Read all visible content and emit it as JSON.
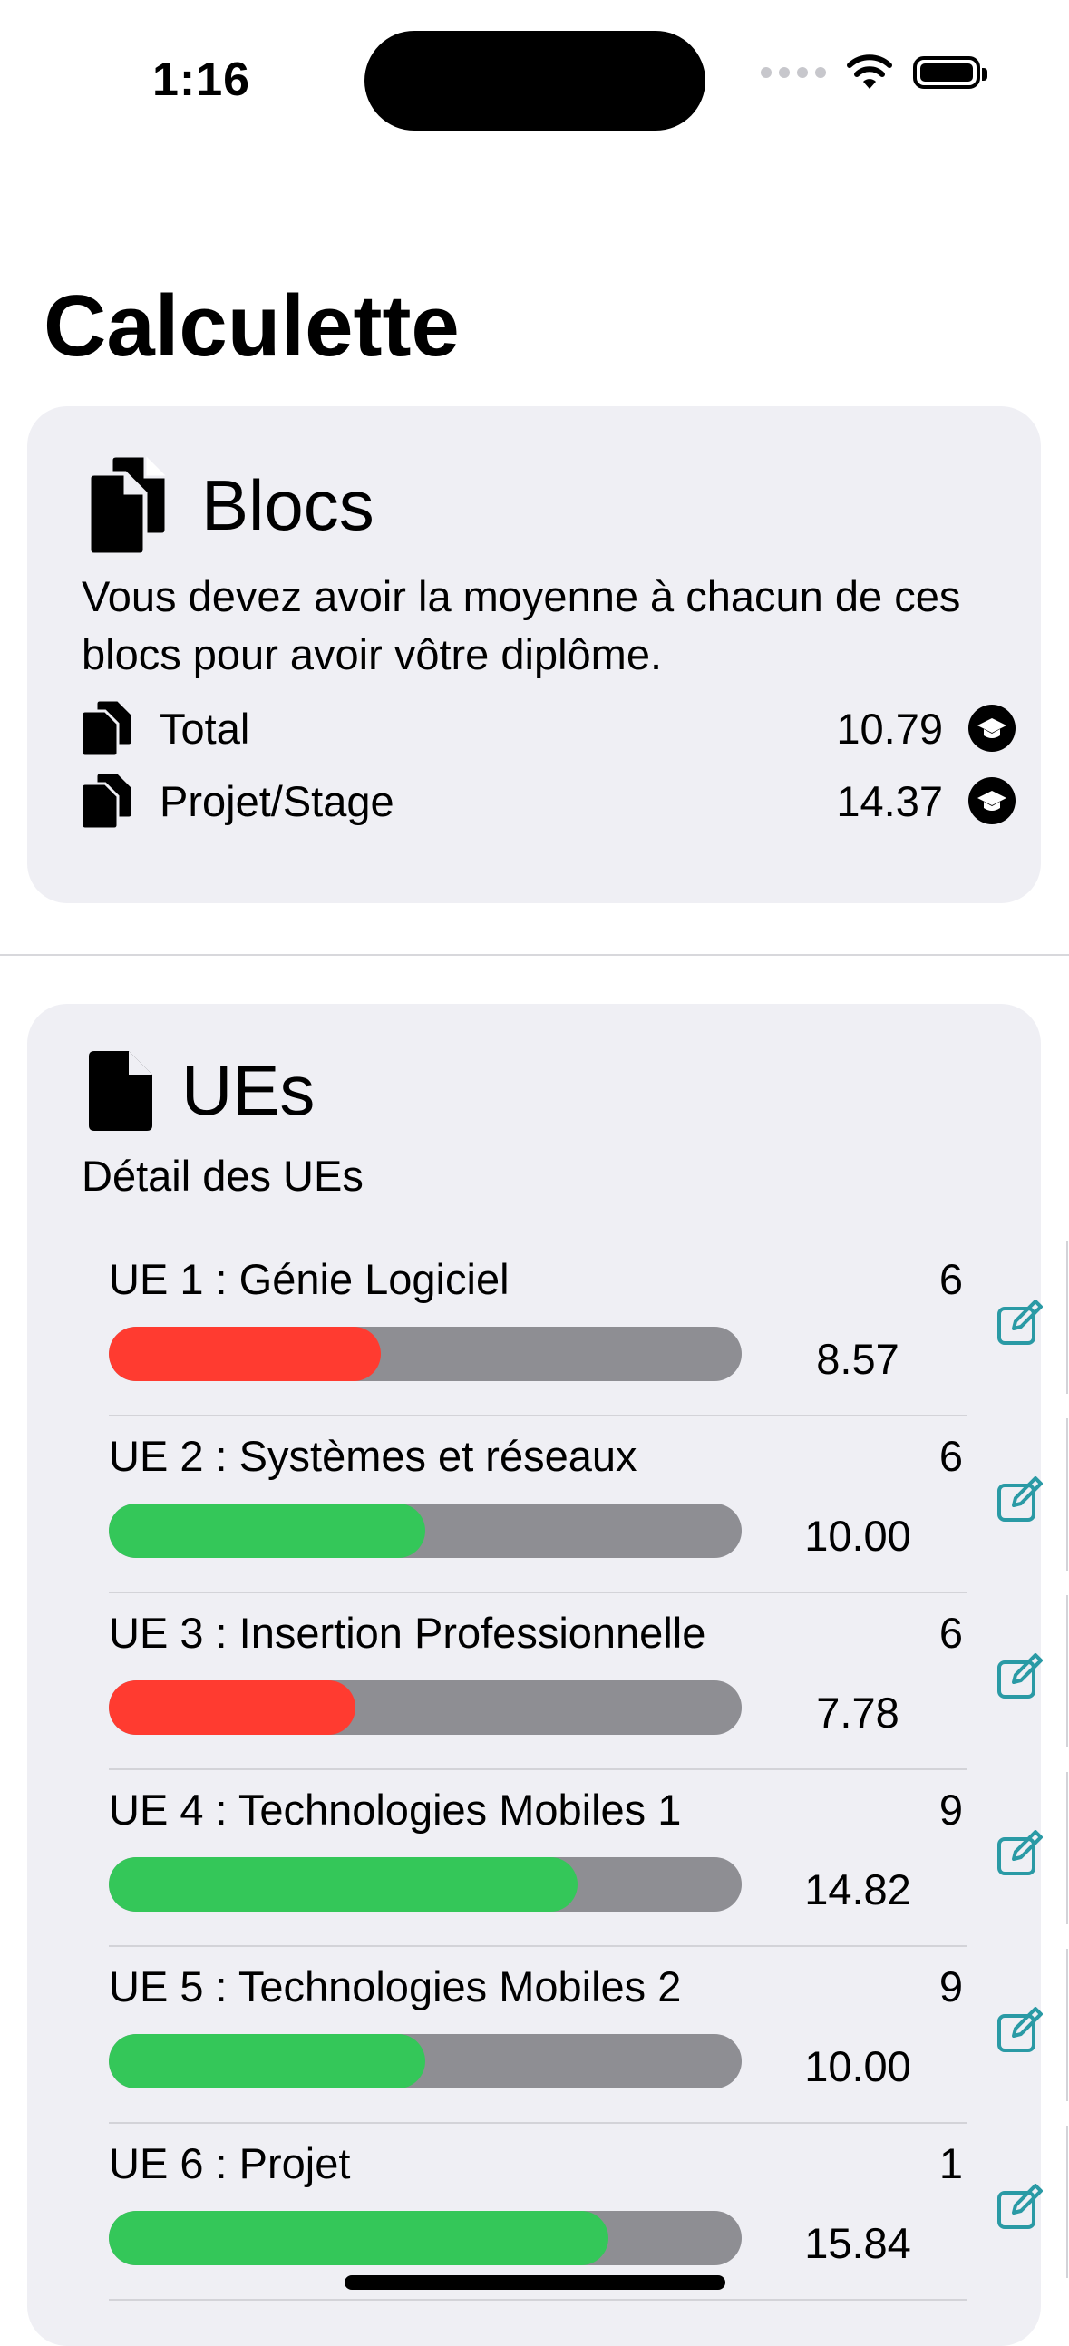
{
  "status_bar": {
    "time": "1:16"
  },
  "page_title": "Calculette",
  "blocs": {
    "title": "Blocs",
    "description": "Vous devez avoir la moyenne à chacun de ces blocs pour avoir vôtre diplôme.",
    "items": [
      {
        "label": "Total",
        "value": "10.79",
        "icon": "graduation-cap-icon"
      },
      {
        "label": "Projet/Stage",
        "value": "14.37",
        "icon": "graduation-cap-icon"
      }
    ]
  },
  "ues": {
    "title": "UEs",
    "subtitle": "Détail des UEs",
    "items": [
      {
        "label": "UE 1 : Génie Logiciel",
        "coef": "6",
        "average": "8.57",
        "progress": 0.43,
        "color": "#ff3b30"
      },
      {
        "label": "UE 2 : Systèmes et réseaux",
        "coef": "6",
        "average": "10.00",
        "progress": 0.5,
        "color": "#34c759"
      },
      {
        "label": "UE 3 : Insertion Professionnelle",
        "coef": "6",
        "average": "7.78",
        "progress": 0.39,
        "color": "#ff3b30"
      },
      {
        "label": "UE 4 : Technologies Mobiles 1",
        "coef": "9",
        "average": "14.82",
        "progress": 0.74,
        "color": "#34c759"
      },
      {
        "label": "UE 5 : Technologies Mobiles 2",
        "coef": "9",
        "average": "10.00",
        "progress": 0.5,
        "color": "#34c759"
      },
      {
        "label": "UE 6 : Projet",
        "coef": "1",
        "average": "15.84",
        "progress": 0.79,
        "color": "#34c759"
      }
    ]
  },
  "colors": {
    "accent": "#2a9aa5",
    "card_background": "#efeff4",
    "bar_track": "#8e8e93"
  }
}
